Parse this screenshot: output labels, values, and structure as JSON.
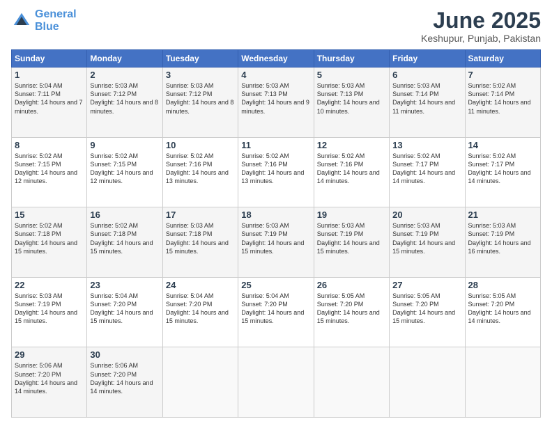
{
  "logo": {
    "line1": "General",
    "line2": "Blue"
  },
  "title": "June 2025",
  "location": "Keshupur, Punjab, Pakistan",
  "weekdays": [
    "Sunday",
    "Monday",
    "Tuesday",
    "Wednesday",
    "Thursday",
    "Friday",
    "Saturday"
  ],
  "weeks": [
    [
      {
        "day": 1,
        "sunrise": "5:04 AM",
        "sunset": "7:11 PM",
        "daylight": "14 hours and 7 minutes."
      },
      {
        "day": 2,
        "sunrise": "5:03 AM",
        "sunset": "7:12 PM",
        "daylight": "14 hours and 8 minutes."
      },
      {
        "day": 3,
        "sunrise": "5:03 AM",
        "sunset": "7:12 PM",
        "daylight": "14 hours and 8 minutes."
      },
      {
        "day": 4,
        "sunrise": "5:03 AM",
        "sunset": "7:13 PM",
        "daylight": "14 hours and 9 minutes."
      },
      {
        "day": 5,
        "sunrise": "5:03 AM",
        "sunset": "7:13 PM",
        "daylight": "14 hours and 10 minutes."
      },
      {
        "day": 6,
        "sunrise": "5:03 AM",
        "sunset": "7:14 PM",
        "daylight": "14 hours and 11 minutes."
      },
      {
        "day": 7,
        "sunrise": "5:02 AM",
        "sunset": "7:14 PM",
        "daylight": "14 hours and 11 minutes."
      }
    ],
    [
      {
        "day": 8,
        "sunrise": "5:02 AM",
        "sunset": "7:15 PM",
        "daylight": "14 hours and 12 minutes."
      },
      {
        "day": 9,
        "sunrise": "5:02 AM",
        "sunset": "7:15 PM",
        "daylight": "14 hours and 12 minutes."
      },
      {
        "day": 10,
        "sunrise": "5:02 AM",
        "sunset": "7:16 PM",
        "daylight": "14 hours and 13 minutes."
      },
      {
        "day": 11,
        "sunrise": "5:02 AM",
        "sunset": "7:16 PM",
        "daylight": "14 hours and 13 minutes."
      },
      {
        "day": 12,
        "sunrise": "5:02 AM",
        "sunset": "7:16 PM",
        "daylight": "14 hours and 14 minutes."
      },
      {
        "day": 13,
        "sunrise": "5:02 AM",
        "sunset": "7:17 PM",
        "daylight": "14 hours and 14 minutes."
      },
      {
        "day": 14,
        "sunrise": "5:02 AM",
        "sunset": "7:17 PM",
        "daylight": "14 hours and 14 minutes."
      }
    ],
    [
      {
        "day": 15,
        "sunrise": "5:02 AM",
        "sunset": "7:18 PM",
        "daylight": "14 hours and 15 minutes."
      },
      {
        "day": 16,
        "sunrise": "5:02 AM",
        "sunset": "7:18 PM",
        "daylight": "14 hours and 15 minutes."
      },
      {
        "day": 17,
        "sunrise": "5:03 AM",
        "sunset": "7:18 PM",
        "daylight": "14 hours and 15 minutes."
      },
      {
        "day": 18,
        "sunrise": "5:03 AM",
        "sunset": "7:19 PM",
        "daylight": "14 hours and 15 minutes."
      },
      {
        "day": 19,
        "sunrise": "5:03 AM",
        "sunset": "7:19 PM",
        "daylight": "14 hours and 15 minutes."
      },
      {
        "day": 20,
        "sunrise": "5:03 AM",
        "sunset": "7:19 PM",
        "daylight": "14 hours and 15 minutes."
      },
      {
        "day": 21,
        "sunrise": "5:03 AM",
        "sunset": "7:19 PM",
        "daylight": "14 hours and 16 minutes."
      }
    ],
    [
      {
        "day": 22,
        "sunrise": "5:03 AM",
        "sunset": "7:19 PM",
        "daylight": "14 hours and 15 minutes."
      },
      {
        "day": 23,
        "sunrise": "5:04 AM",
        "sunset": "7:20 PM",
        "daylight": "14 hours and 15 minutes."
      },
      {
        "day": 24,
        "sunrise": "5:04 AM",
        "sunset": "7:20 PM",
        "daylight": "14 hours and 15 minutes."
      },
      {
        "day": 25,
        "sunrise": "5:04 AM",
        "sunset": "7:20 PM",
        "daylight": "14 hours and 15 minutes."
      },
      {
        "day": 26,
        "sunrise": "5:05 AM",
        "sunset": "7:20 PM",
        "daylight": "14 hours and 15 minutes."
      },
      {
        "day": 27,
        "sunrise": "5:05 AM",
        "sunset": "7:20 PM",
        "daylight": "14 hours and 15 minutes."
      },
      {
        "day": 28,
        "sunrise": "5:05 AM",
        "sunset": "7:20 PM",
        "daylight": "14 hours and 14 minutes."
      }
    ],
    [
      {
        "day": 29,
        "sunrise": "5:06 AM",
        "sunset": "7:20 PM",
        "daylight": "14 hours and 14 minutes."
      },
      {
        "day": 30,
        "sunrise": "5:06 AM",
        "sunset": "7:20 PM",
        "daylight": "14 hours and 14 minutes."
      },
      null,
      null,
      null,
      null,
      null
    ]
  ]
}
